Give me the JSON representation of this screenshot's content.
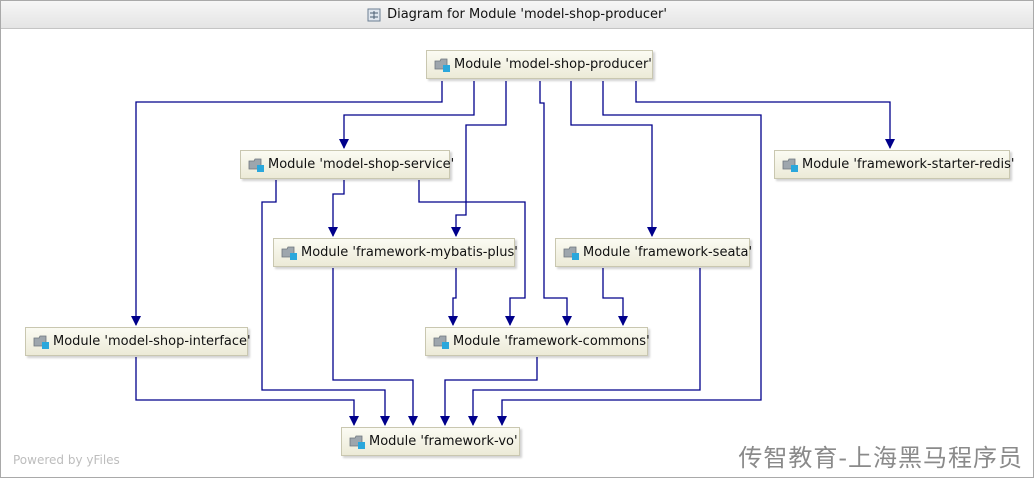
{
  "window": {
    "title": "Diagram for Module 'model-shop-producer'"
  },
  "nodes": {
    "producer": "Module 'model-shop-producer'",
    "service": "Module 'model-shop-service'",
    "redis": "Module 'framework-starter-redis'",
    "mybatis": "Module 'framework-mybatis-plus'",
    "seata": "Module 'framework-seata'",
    "interface": "Module 'model-shop-interface'",
    "commons": "Module 'framework-commons'",
    "vo": "Module 'framework-vo'"
  },
  "footer": {
    "powered_by": "Powered by yFiles",
    "watermark": "传智教育-上海黑马程序员"
  },
  "colors": {
    "edge": "#00008b",
    "node_fill": "#f3f1e2",
    "node_border": "#c9c7b0"
  },
  "icons": {
    "title": "diagram-icon",
    "node": "module-folder-icon"
  }
}
